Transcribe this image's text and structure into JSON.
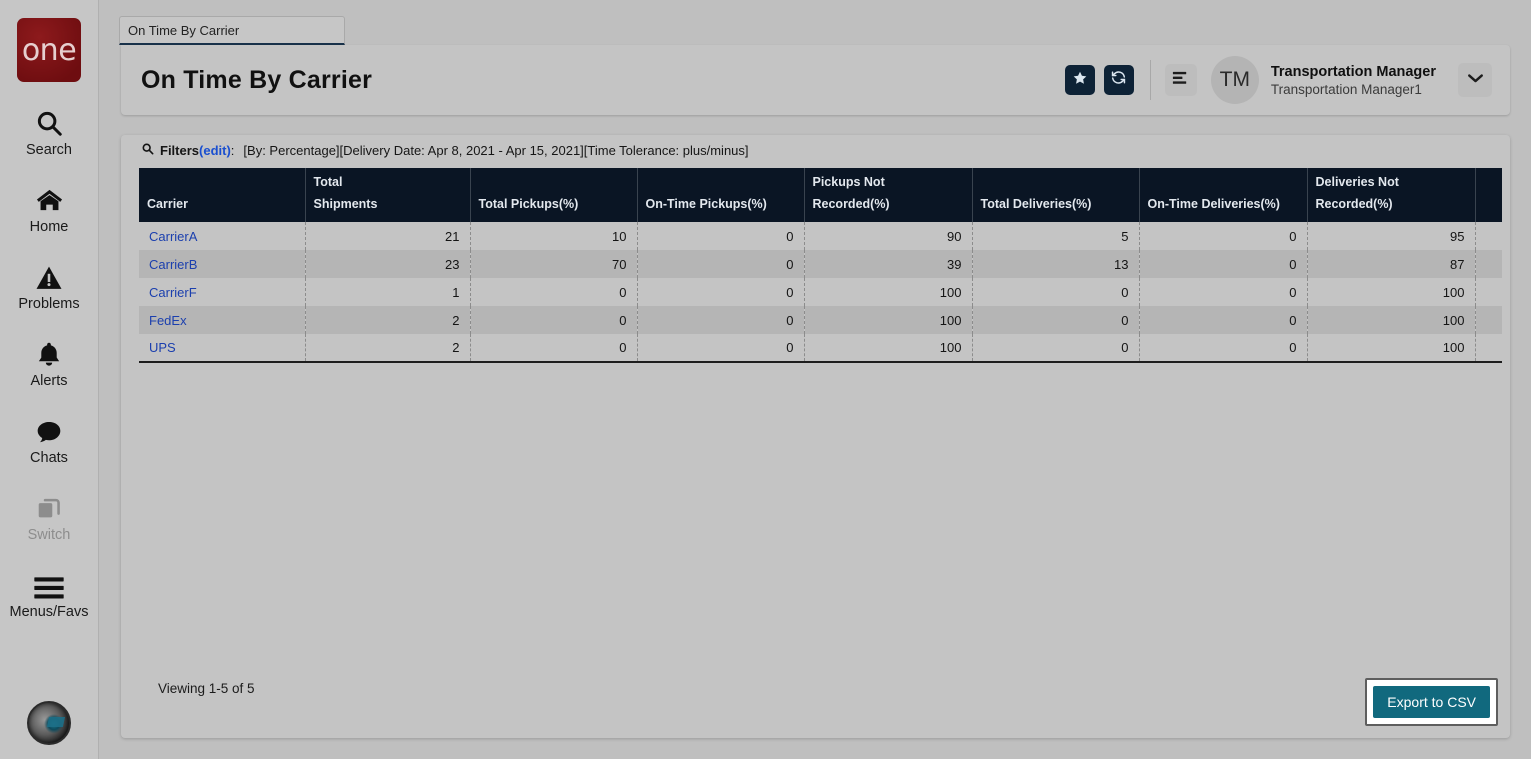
{
  "brand": {
    "logo_text": "one"
  },
  "sidebar": {
    "items": [
      {
        "label": "Search",
        "icon": "search-icon",
        "disabled": false
      },
      {
        "label": "Home",
        "icon": "home-icon",
        "disabled": false
      },
      {
        "label": "Problems",
        "icon": "warning-icon",
        "disabled": false
      },
      {
        "label": "Alerts",
        "icon": "bell-icon",
        "disabled": false
      },
      {
        "label": "Chats",
        "icon": "chat-icon",
        "disabled": false
      },
      {
        "label": "Switch",
        "icon": "switch-icon",
        "disabled": true
      },
      {
        "label": "Menus/Favs",
        "icon": "hamburger-icon",
        "disabled": false
      }
    ],
    "avatar": "user-avatar-image"
  },
  "tab": {
    "label": "On Time By Carrier"
  },
  "header": {
    "title": "On Time By Carrier",
    "favorite_icon": "star-icon",
    "refresh_icon": "refresh-icon",
    "list_icon": "list-icon",
    "avatar_initials": "TM",
    "user_name": "Transportation Manager",
    "user_sub": "Transportation Manager1",
    "chevron_icon": "chevron-down-icon"
  },
  "filters": {
    "icon": "search-icon",
    "label": "Filters",
    "edit_label": "(edit)",
    "colon": ":",
    "criteria": "[By: Percentage][Delivery Date: Apr 8, 2021 - Apr 15, 2021][Time Tolerance: plus/minus]"
  },
  "table": {
    "columns": [
      "Carrier",
      "Total\nShipments",
      "Total Pickups(%)",
      "On-Time Pickups(%)",
      "Pickups Not Recorded(%)",
      "Total Deliveries(%)",
      "On-Time Deliveries(%)",
      "Deliveries Not Recorded(%)",
      ""
    ],
    "rows": [
      {
        "carrier": "CarrierA",
        "total_shipments": "21",
        "total_pickups": "10",
        "on_time_pickups": "0",
        "pickups_not_recorded": "90",
        "total_deliveries": "5",
        "on_time_deliveries": "0",
        "deliveries_not_recorded": "95",
        "pad": ""
      },
      {
        "carrier": "CarrierB",
        "total_shipments": "23",
        "total_pickups": "70",
        "on_time_pickups": "0",
        "pickups_not_recorded": "39",
        "total_deliveries": "13",
        "on_time_deliveries": "0",
        "deliveries_not_recorded": "87",
        "pad": ""
      },
      {
        "carrier": "CarrierF",
        "total_shipments": "1",
        "total_pickups": "0",
        "on_time_pickups": "0",
        "pickups_not_recorded": "100",
        "total_deliveries": "0",
        "on_time_deliveries": "0",
        "deliveries_not_recorded": "100",
        "pad": ""
      },
      {
        "carrier": "FedEx",
        "total_shipments": "2",
        "total_pickups": "0",
        "on_time_pickups": "0",
        "pickups_not_recorded": "100",
        "total_deliveries": "0",
        "on_time_deliveries": "0",
        "deliveries_not_recorded": "100",
        "pad": ""
      },
      {
        "carrier": "UPS",
        "total_shipments": "2",
        "total_pickups": "0",
        "on_time_pickups": "0",
        "pickups_not_recorded": "100",
        "total_deliveries": "0",
        "on_time_deliveries": "0",
        "deliveries_not_recorded": "100",
        "pad": ""
      }
    ]
  },
  "footer": {
    "viewing": "Viewing 1-5 of 5",
    "export_label": "Export to CSV"
  },
  "colors": {
    "header_dark": "#0a1524",
    "accent_link": "#1b3fae",
    "brand_red": "#7b1113",
    "export_teal": "#11697e",
    "tab_underline": "#18314a"
  }
}
